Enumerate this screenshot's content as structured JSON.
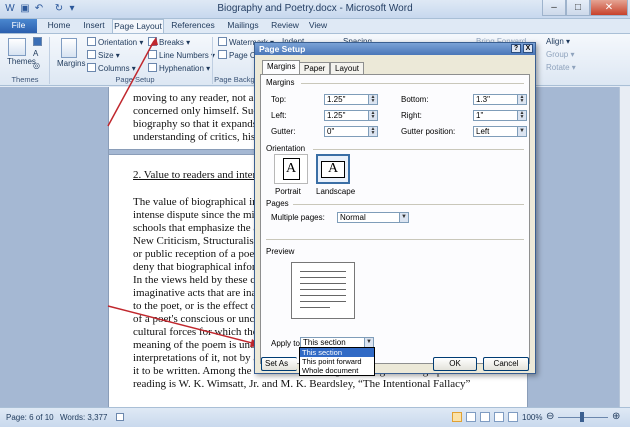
{
  "window": {
    "title": "Biography and Poetry.docx - Microsoft Word",
    "minimize": "–",
    "maximize": "□",
    "close": "✕"
  },
  "tabs": [
    "File",
    "Home",
    "Insert",
    "Page Layout",
    "References",
    "Mailings",
    "Review",
    "View"
  ],
  "ribbon": {
    "themes": {
      "label": "Themes",
      "group": "Themes"
    },
    "margins": "Margins",
    "orientation": "Orientation ▾",
    "size": "Size ▾",
    "columns": "Columns ▾",
    "breaks": "Breaks ▾",
    "line_numbers": "Line Numbers ▾",
    "hyphenation": "Hyphenation ▾",
    "page_setup_group": "Page Setup",
    "watermark": "Watermark ▾",
    "page_color": "Page Color ▾",
    "page_background_group": "Page Background",
    "indent": "Indent",
    "spacing": "Spacing",
    "bring_forward": "Bring Forward",
    "align": "Align ▾",
    "group": "Group ▾",
    "rotate": "Rotate ▾"
  },
  "document": {
    "lines_top": [
      "moving to any reader, not a",
      "concerned only himself. Suc",
      "biography so that it expands",
      "understanding of critics, his"
    ],
    "heading": "2. Value to readers and inter",
    "lines": [
      "The value of biographical in",
      "intense dispute since the mi",
      "schools that emphasize the a",
      "New Criticism, Structuralism",
      "or public reception of a poe",
      "deny that biographical infor",
      "In the views held by these c",
      "imaginative acts that are ina",
      "to the poet, or is the effect o",
      "of a poet's conscious or unco",
      "cultural forces for which the",
      "meaning of the poem is und",
      "interpretations of it, not by a",
      "it to be written. Among the most influential arguments against biographical",
      "reading is W. K. Wimsatt, Jr. and M. K. Beardsley, “The Intentional Fallacy”"
    ]
  },
  "status": {
    "page": "Page: 6 of 10",
    "words": "Words: 3,377",
    "zoom": "100%"
  },
  "dialog": {
    "title": "Page Setup",
    "help": "?",
    "close": "X",
    "tabs": [
      "Margins",
      "Paper",
      "Layout"
    ],
    "margins_section": "Margins",
    "top_label": "Top:",
    "top_value": "1.25\"",
    "bottom_label": "Bottom:",
    "bottom_value": "1.3\"",
    "left_label": "Left:",
    "left_value": "1.25\"",
    "right_label": "Right:",
    "right_value": "1\"",
    "gutter_label": "Gutter:",
    "gutter_value": "0\"",
    "gutter_position_label": "Gutter position:",
    "gutter_position_value": "Left",
    "orientation_section": "Orientation",
    "portrait": "Portrait",
    "landscape": "Landscape",
    "pages_section": "Pages",
    "multiple_pages_label": "Multiple pages:",
    "multiple_pages_value": "Normal",
    "preview_section": "Preview",
    "apply_to_label": "Apply to:",
    "apply_to_value": "This section",
    "apply_to_options": [
      "This section",
      "This point forward",
      "Whole document"
    ],
    "set_as_default": "Set As Defa",
    "ok": "OK",
    "cancel": "Cancel"
  }
}
